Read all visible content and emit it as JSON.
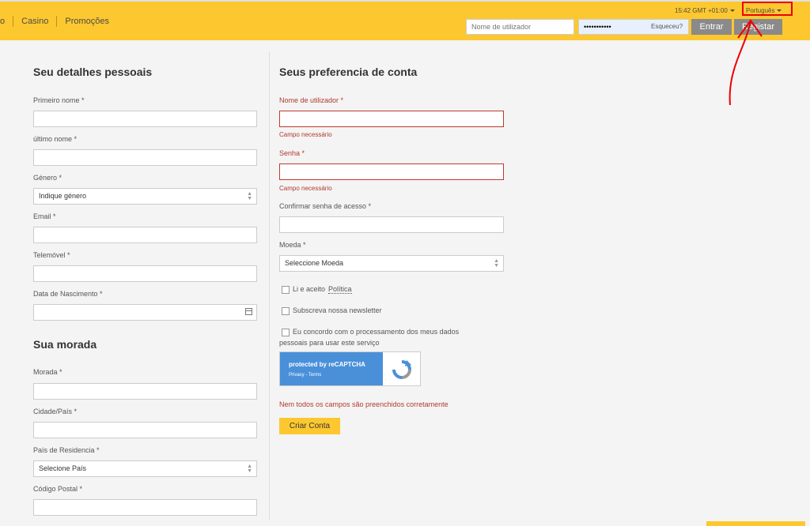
{
  "nav": [
    "o",
    "Casino",
    "Promoções"
  ],
  "time": "15:42 GMT +01:00",
  "language": "Português",
  "login": {
    "username_placeholder": "Nome de utilizador",
    "password_value": "•••••••••••",
    "forgot": "Esqueceu?",
    "enter": "Entrar",
    "register": "Registar"
  },
  "personal": {
    "title": "Seu detalhes pessoais",
    "first_name": "Primeiro nome *",
    "last_name": "último nome *",
    "gender": "Género *",
    "gender_select": "Indique género",
    "email": "Email *",
    "mobile": "Telemóvel *",
    "birth": "Data de Nascimento *"
  },
  "address": {
    "title": "Sua morada",
    "address": "Morada *",
    "city": "Cidade/País *",
    "country": "País de Residencia *",
    "country_select": "Selecione País",
    "postal": "Código Postal *"
  },
  "account": {
    "title": "Seus preferencia de conta",
    "username": "Nome de utilizador *",
    "username_hint": "Campo necessário",
    "password": "Senha *",
    "password_hint": "Campo necessário",
    "confirm": "Confirmar senha de acesso *",
    "currency": "Moeda *",
    "currency_select": "Seleccione Moeda",
    "accept_text": "Li e aceito",
    "policy": "Política",
    "newsletter": "Subscreva nossa newsletter",
    "consent_line1": "Eu concordo com o processamento dos meus dados",
    "consent_line2": "pessoais para usar este serviço",
    "error": "Nem todos os campos são preenchidos corretamente",
    "create": "Criar Conta"
  },
  "captcha": {
    "line1": "protected by reCAPTCHA",
    "line2": "Privacy - Terms"
  },
  "colors": {
    "brand": "#fdc82f",
    "error": "#b03a2e",
    "button_gray": "#8a8a8a",
    "captcha_blue": "#4a90d9",
    "annotation": "#e00000"
  }
}
